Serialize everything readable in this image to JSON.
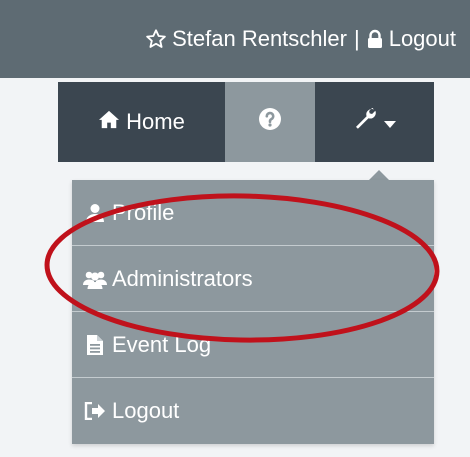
{
  "header": {
    "user_name": "Stefan Rentschler",
    "separator": "|",
    "logout_label": "Logout"
  },
  "nav": {
    "home_label": "Home",
    "help_icon": "question-circle-icon",
    "tools_icon": "wrench-icon"
  },
  "dropdown": {
    "items": [
      {
        "label": "Profile",
        "icon": "user-icon"
      },
      {
        "label": "Administrators",
        "icon": "users-icon"
      },
      {
        "label": "Event Log",
        "icon": "file-text-icon"
      },
      {
        "label": "Logout",
        "icon": "sign-out-icon"
      }
    ]
  },
  "colors": {
    "topbar": "#5e6b73",
    "nav_dark": "#3b4650",
    "nav_active": "#8d989e",
    "menu_bg": "#8d989e",
    "annotation": "#c0111b"
  }
}
